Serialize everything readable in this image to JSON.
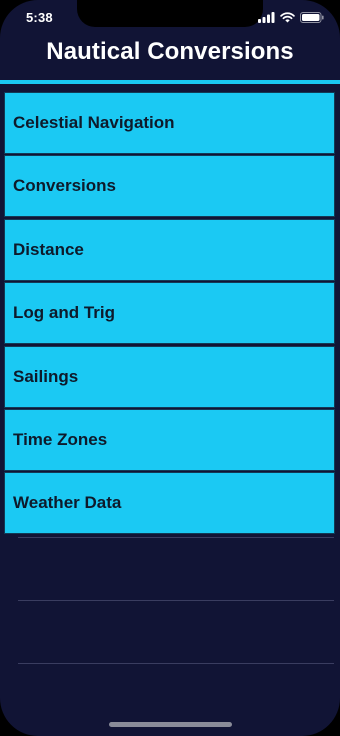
{
  "status_bar": {
    "time": "5:38",
    "icons": [
      "signal-icon",
      "wifi-icon",
      "battery-icon"
    ]
  },
  "nav": {
    "title": "Nautical Conversions"
  },
  "menu": {
    "items": [
      {
        "label": "Celestial Navigation"
      },
      {
        "label": "Conversions"
      },
      {
        "label": "Distance"
      },
      {
        "label": "Log and Trig"
      },
      {
        "label": "Sailings"
      },
      {
        "label": "Time Zones"
      },
      {
        "label": "Weather Data"
      }
    ]
  },
  "colors": {
    "background": "#111435",
    "accent": "#1ac8f2",
    "row_text": "#0e1a2b",
    "title_text": "#ffffff"
  }
}
